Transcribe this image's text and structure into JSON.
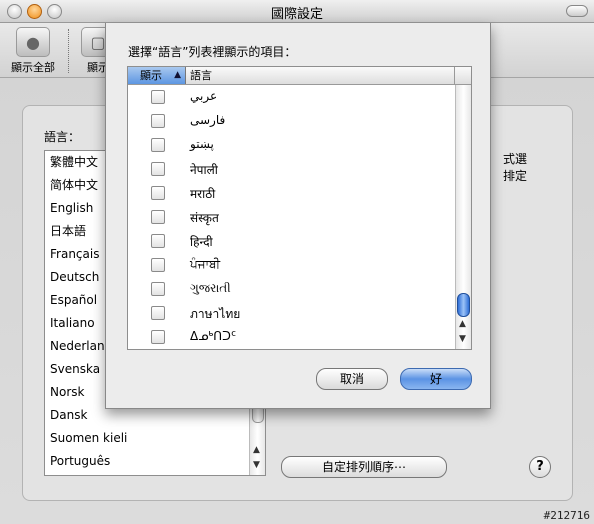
{
  "window": {
    "title": "國際設定"
  },
  "toolbar": {
    "show_all_label": "顯示全部",
    "second_label": "顯示"
  },
  "panel": {
    "languages_label": "語言：",
    "languages": [
      "繁體中文",
      "简体中文",
      "English",
      "日本語",
      "Français",
      "Deutsch",
      "Español",
      "Italiano",
      "Nederland",
      "Svenska",
      "Norsk",
      "Dansk",
      "Suomen kieli",
      "Português"
    ],
    "right_text_line1": "式選",
    "right_text_line2": "排定",
    "custom_order_button": "自定排列順序⋯",
    "help_button": "?"
  },
  "sheet": {
    "title": "選擇“語言”列表裡顯示的項目：",
    "col_show": "顯示",
    "col_language": "語言",
    "rows": [
      {
        "label": "عربي",
        "checked": false
      },
      {
        "label": "فارسی",
        "checked": false
      },
      {
        "label": "پښتو",
        "checked": false
      },
      {
        "label": "नेपाली",
        "checked": false
      },
      {
        "label": "मराठी",
        "checked": false
      },
      {
        "label": "संस्कृत",
        "checked": false
      },
      {
        "label": "हिन्दी",
        "checked": false
      },
      {
        "label": "ਪੰਜਾਬੀ",
        "checked": false
      },
      {
        "label": "ગુજરાતી",
        "checked": false
      },
      {
        "label": "ภาษาไทย",
        "checked": false
      },
      {
        "label": "ᐃᓄᒃᑎᑐᑦ",
        "checked": false
      }
    ],
    "cancel_button": "取消",
    "ok_button": "好"
  },
  "watermark": "#212716"
}
